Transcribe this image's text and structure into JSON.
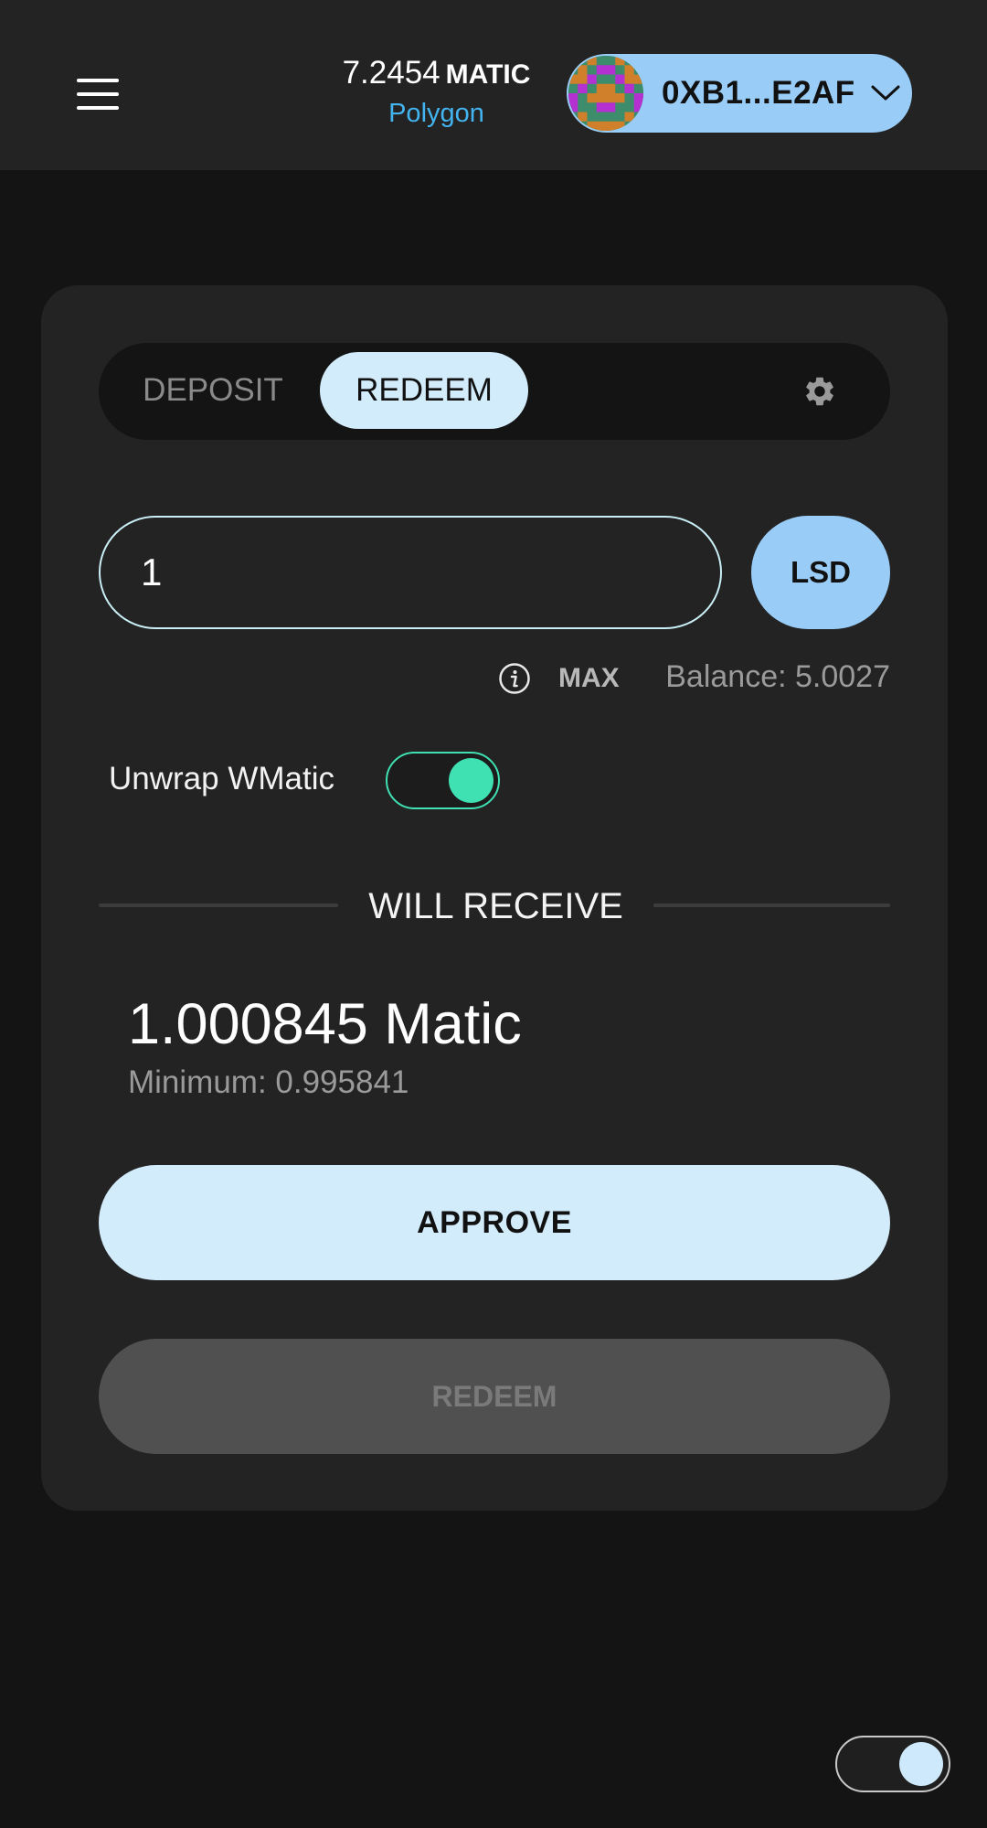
{
  "header": {
    "balance_amount": "7.2454",
    "balance_unit": "MATIC",
    "network": "Polygon",
    "wallet_address": "0XB1...E2AF"
  },
  "tabs": {
    "deposit_label": "DEPOSIT",
    "redeem_label": "REDEEM",
    "active": "REDEEM"
  },
  "form": {
    "amount_value": "1",
    "token_label": "LSD",
    "max_label": "MAX",
    "balance_text": "Balance: 5.0027",
    "unwrap_label": "Unwrap WMatic",
    "unwrap_enabled": true
  },
  "receive": {
    "heading": "WILL RECEIVE",
    "amount": "1.000845 Matic",
    "minimum": "Minimum: 0.995841"
  },
  "actions": {
    "approve_label": "APPROVE",
    "redeem_label": "REDEEM",
    "redeem_disabled": true
  },
  "theme": {
    "dark_mode": true
  },
  "colors": {
    "accent_blue": "#99cdf8",
    "accent_light": "#d3ecfc",
    "toggle_green": "#3fe0b2",
    "network_blue": "#43b4f0"
  },
  "icons": {
    "menu": "hamburger-menu-icon",
    "wallet_chevron": "chevron-down-icon",
    "settings": "gear-icon",
    "info": "info-icon"
  }
}
